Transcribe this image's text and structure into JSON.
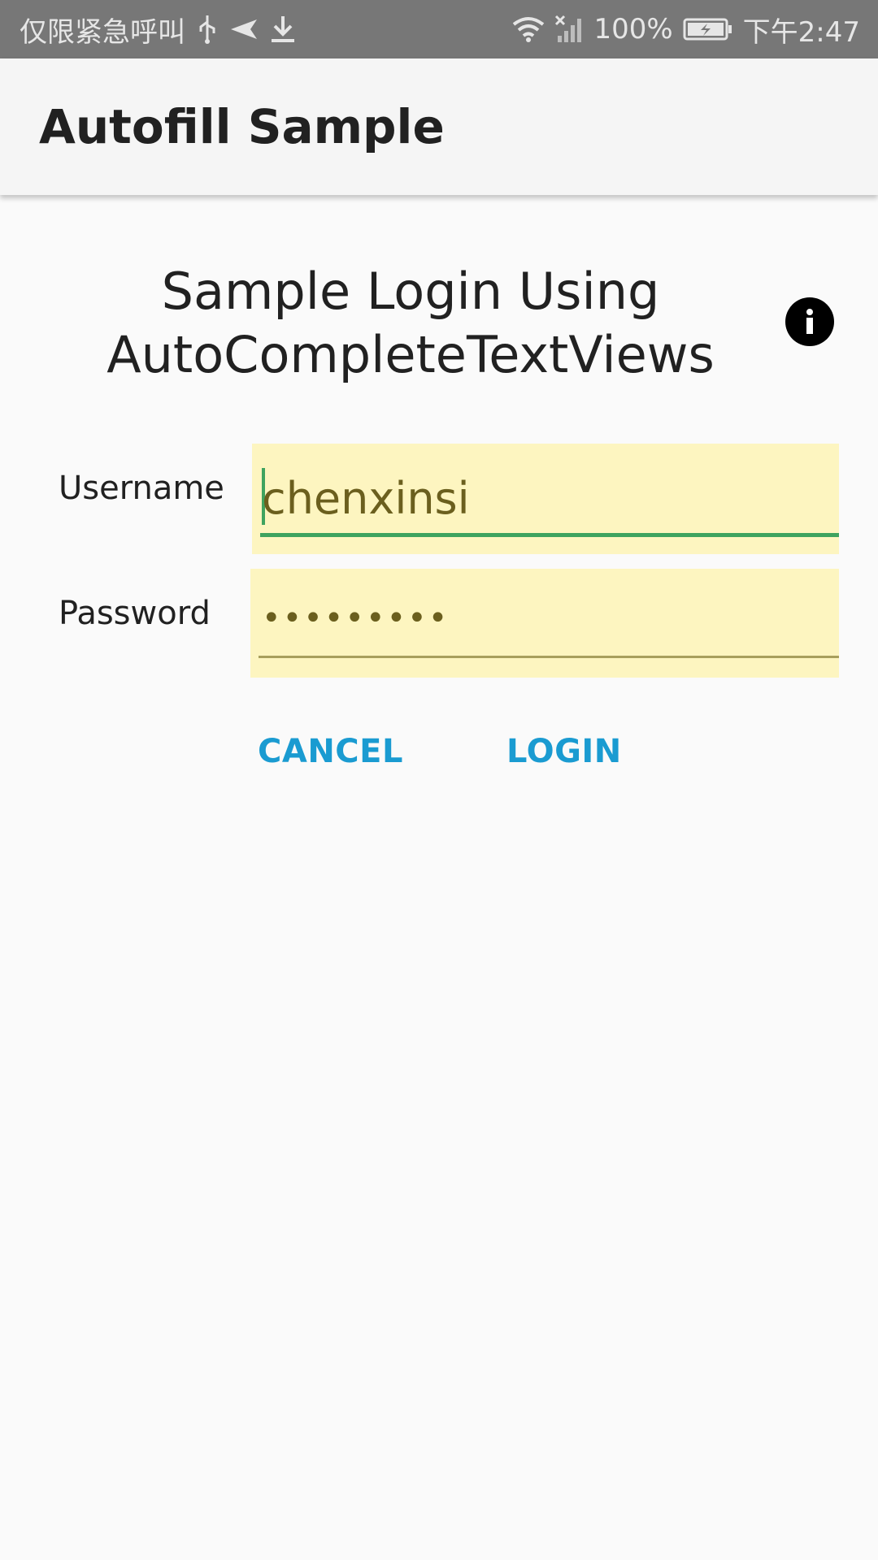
{
  "status_bar": {
    "carrier_text": "仅限紧急呼叫",
    "icons": [
      "usb-icon",
      "send-icon",
      "download-icon",
      "wifi-icon",
      "no-signal-icon",
      "battery-charging-icon"
    ],
    "battery_percent": "100%",
    "time": "下午2:47"
  },
  "app_bar": {
    "title": "Autofill Sample"
  },
  "login": {
    "heading_line1": "Sample Login Using",
    "heading_line2": "AutoCompleteTextViews",
    "info_icon": "info-icon",
    "username_label": "Username",
    "username_value": "chenxinsi",
    "password_label": "Password",
    "password_value": "•••••••••",
    "cancel_label": "CANCEL",
    "login_label": "LOGIN"
  },
  "colors": {
    "accent": "#1a9bd1",
    "focused_underline": "#3fa35f",
    "autofill_background": "#fdf5c0",
    "status_bar": "#777777"
  }
}
